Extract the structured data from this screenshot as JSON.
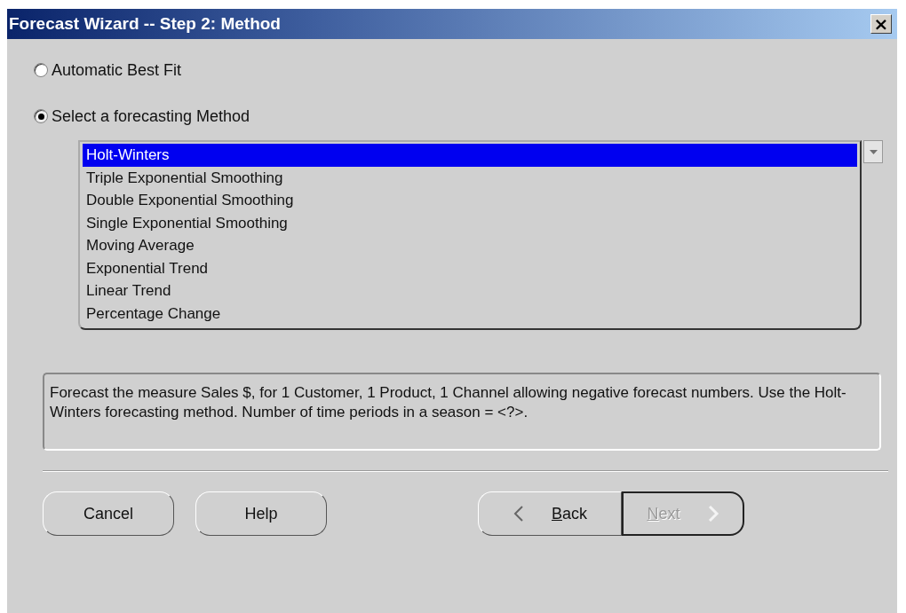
{
  "window": {
    "title": "Forecast Wizard -- Step 2: Method",
    "close": "×"
  },
  "options": [
    {
      "label": "Automatic Best Fit",
      "selected": false
    },
    {
      "label": "Select a forecasting Method",
      "selected": true
    }
  ],
  "methods": [
    {
      "label": "Holt-Winters",
      "selected": true
    },
    {
      "label": "Triple Exponential Smoothing",
      "selected": false
    },
    {
      "label": "Double Exponential Smoothing",
      "selected": false
    },
    {
      "label": "Single Exponential Smoothing",
      "selected": false
    },
    {
      "label": "Moving Average",
      "selected": false
    },
    {
      "label": "Exponential Trend",
      "selected": false
    },
    {
      "label": "Linear Trend",
      "selected": false
    },
    {
      "label": "Percentage Change",
      "selected": false
    }
  ],
  "description": "Forecast the measure Sales $, for 1 Customer, 1 Product, 1 Channel allowing negative forecast numbers. Use the Holt-Winters forecasting method. Number of time periods in a season = <?>.",
  "buttons": [
    {
      "label": "Cancel",
      "kind": "plain",
      "disabled": false
    },
    {
      "label": "Help",
      "kind": "plain",
      "disabled": false
    },
    {
      "label": "Back",
      "kind": "back",
      "disabled": false
    },
    {
      "label": "Next",
      "kind": "next",
      "disabled": true
    }
  ]
}
